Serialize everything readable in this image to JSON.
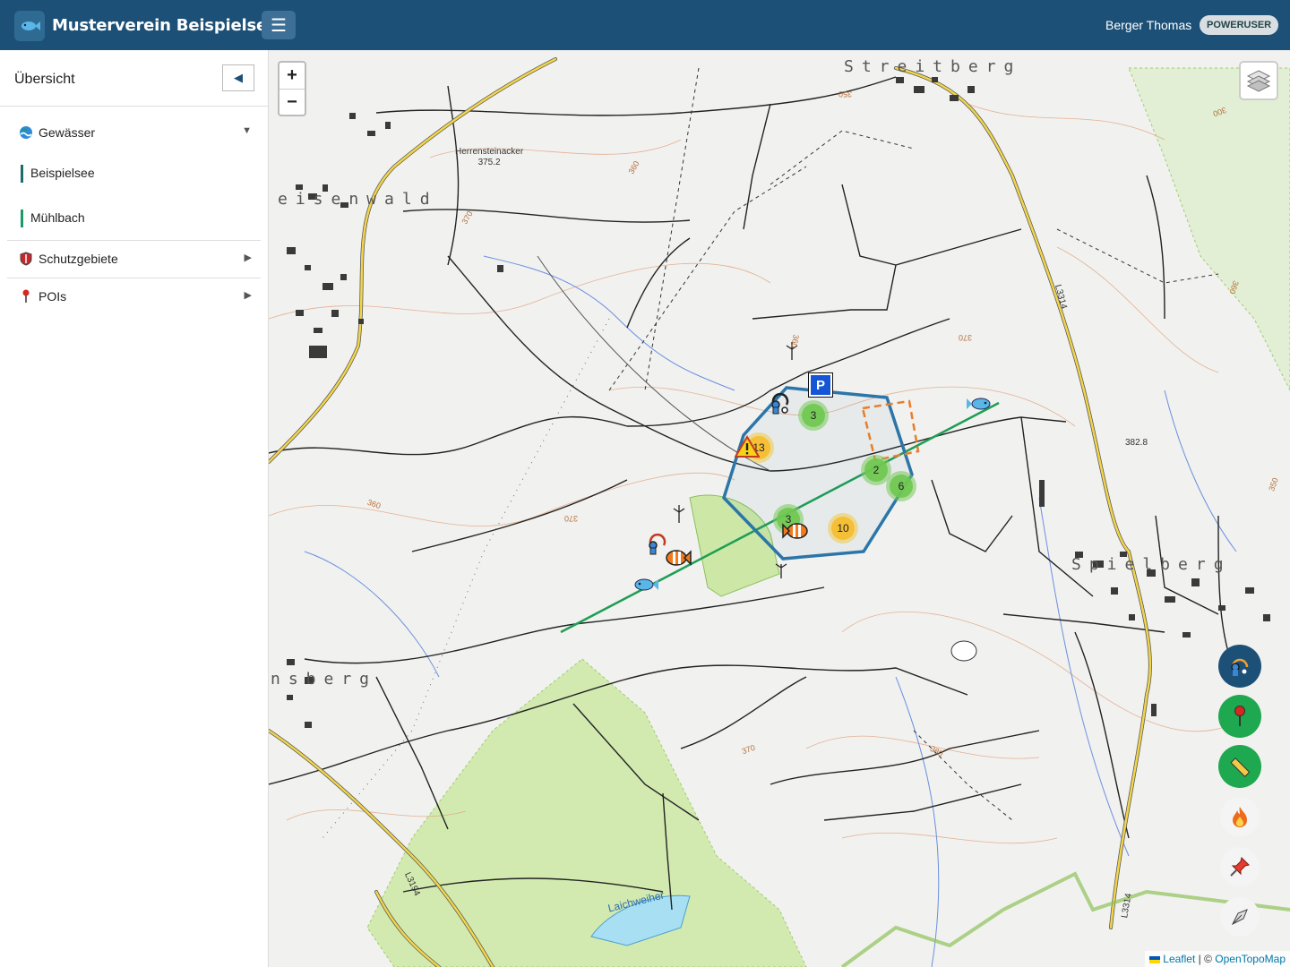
{
  "header": {
    "app_title": "Musterverein Beispielsee",
    "user_name": "Berger Thomas",
    "role_badge": "POWERUSER",
    "menu_icon": "hamburger-icon",
    "logo_icon": "fish-logo-icon"
  },
  "sidebar": {
    "title": "Übersicht",
    "collapse_icon": "◀",
    "sections": [
      {
        "label": "Gewässer",
        "icon": "water-icon",
        "expanded": true,
        "caret": "▼",
        "items": [
          {
            "label": "Beispielsee",
            "accent": "#1d6b6b"
          },
          {
            "label": "Mühlbach",
            "accent": "#1a9a67"
          }
        ]
      },
      {
        "label": "Schutzgebiete",
        "icon": "shield-icon",
        "expanded": false,
        "caret": "▶"
      },
      {
        "label": "POIs",
        "icon": "pin-icon",
        "expanded": false,
        "caret": "▶"
      }
    ]
  },
  "map": {
    "zoom_in": "+",
    "zoom_out": "−",
    "labels": {
      "town_north": "Streitberg",
      "town_west": "eisenwald",
      "town_east": "Spielberg",
      "town_sw": "nsberg",
      "field": "Herrensteinacker",
      "field_height": "375.2",
      "height_east": "382.8",
      "lake": "Laichweiher",
      "road_1": "L3314",
      "road_2": "L3194",
      "road_3": "L3314"
    },
    "contours": [
      "350",
      "360",
      "370",
      "360",
      "370",
      "360",
      "370",
      "380",
      "300",
      "350",
      "360",
      "370"
    ],
    "clusters": [
      {
        "count": "3",
        "kind": "green"
      },
      {
        "count": "13",
        "kind": "yellow"
      },
      {
        "count": "2",
        "kind": "green"
      },
      {
        "count": "6",
        "kind": "green"
      },
      {
        "count": "3",
        "kind": "green"
      },
      {
        "count": "10",
        "kind": "yellow"
      }
    ],
    "parking_label": "P",
    "attribution": {
      "leaflet": "Leaflet",
      "sep": " | © ",
      "provider": "OpenTopoMap"
    }
  },
  "tools": {
    "angler_icon": "angler-icon",
    "poi_icon": "pin-icon",
    "measure_icon": "ruler-icon",
    "fire_icon": "fire-icon",
    "pushpin_icon": "pushpin-icon",
    "draw_icon": "draw-icon"
  },
  "colors": {
    "header": "#1d5077",
    "zone_outline": "#2b75a8",
    "fishing_line": "#1e9e55",
    "restricted_box": "#e87d2a"
  }
}
